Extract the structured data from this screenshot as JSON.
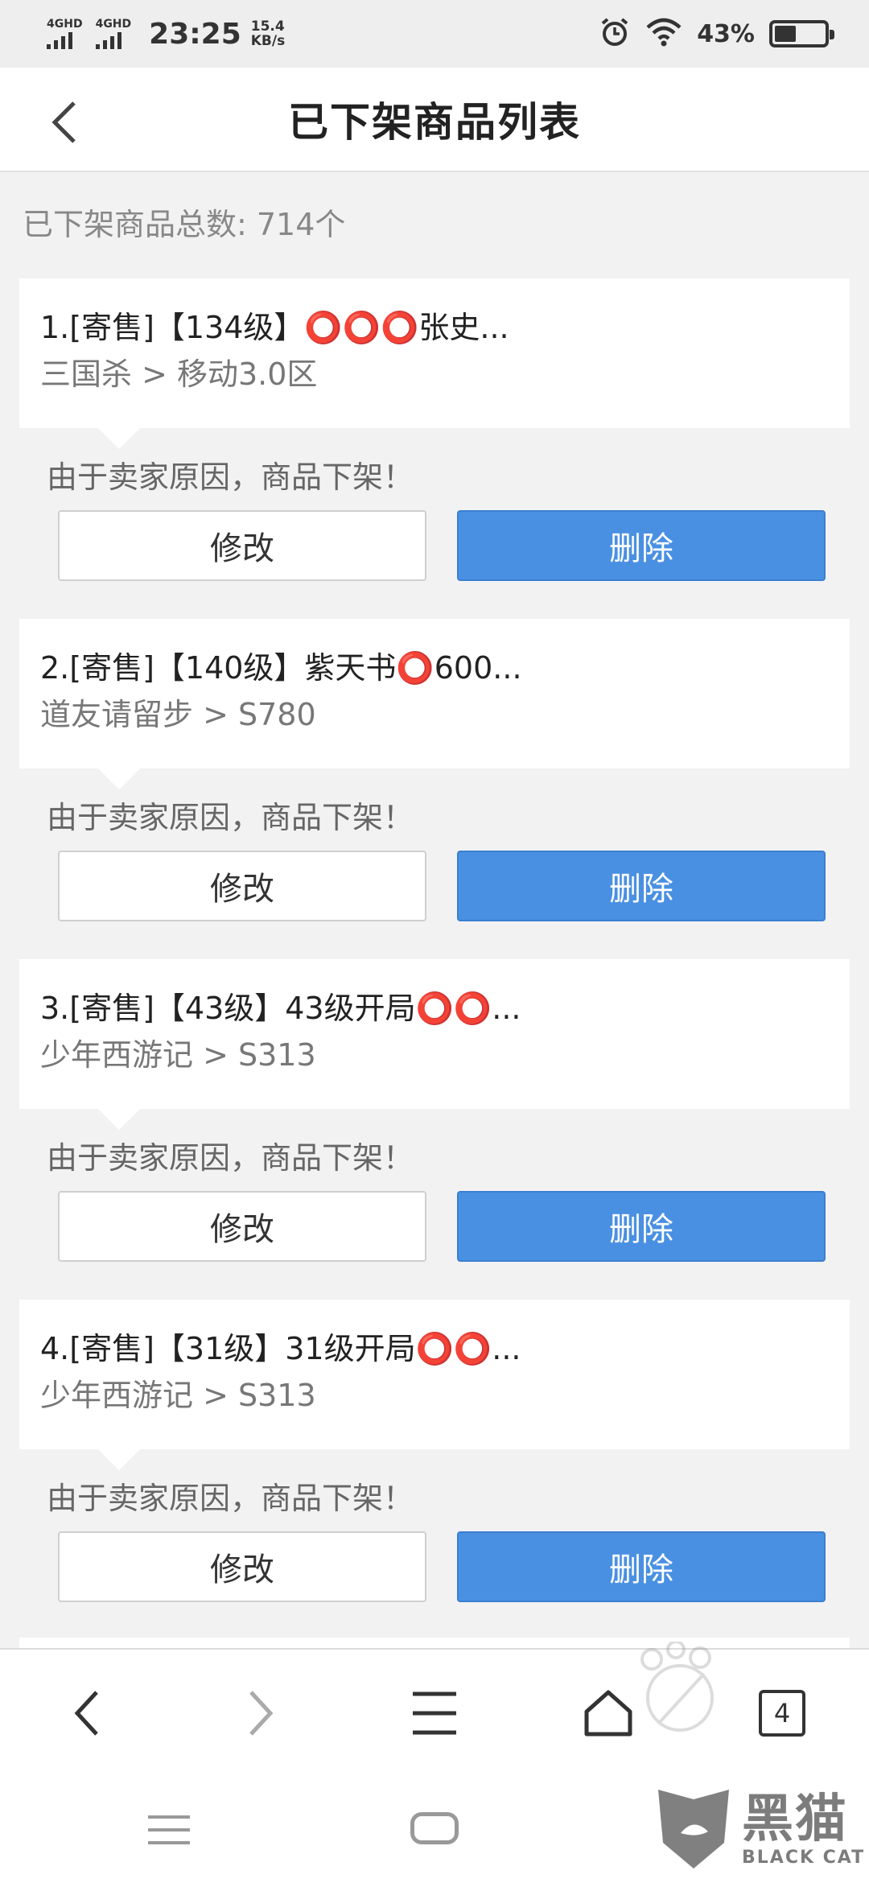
{
  "status_bar": {
    "sim1_label": "4GHD",
    "sim2_label": "4GHD",
    "time": "23:25",
    "speed_value": "15.4",
    "speed_unit": "KB/s",
    "battery_percent": "43%",
    "battery_level": 0.43
  },
  "header": {
    "title": "已下架商品列表"
  },
  "summary": {
    "text": "已下架商品总数: 714个"
  },
  "items": [
    {
      "title": "1.[寄售]【134级】⭕⭕⭕张史...",
      "subtitle": "三国杀 > 移动3.0区",
      "reason": "由于卖家原因，商品下架！",
      "edit_label": "修改",
      "delete_label": "删除"
    },
    {
      "title": "2.[寄售]【140级】紫天书⭕600...",
      "subtitle": "道友请留步 > S780",
      "reason": "由于卖家原因，商品下架！",
      "edit_label": "修改",
      "delete_label": "删除"
    },
    {
      "title": "3.[寄售]【43级】43级开局⭕⭕...",
      "subtitle": "少年西游记 > S313",
      "reason": "由于卖家原因，商品下架！",
      "edit_label": "修改",
      "delete_label": "删除"
    },
    {
      "title": "4.[寄售]【31级】31级开局⭕⭕...",
      "subtitle": "少年西游记 > S313",
      "reason": "由于卖家原因，商品下架！",
      "edit_label": "修改",
      "delete_label": "删除"
    }
  ],
  "browser_bar": {
    "tab_count": "4",
    "icons": [
      "back-arrow-icon",
      "forward-arrow-icon",
      "menu-icon",
      "home-icon",
      "tabs-icon"
    ]
  },
  "watermark": {
    "cn": "黑猫",
    "en": "BLACK CAT"
  },
  "colors": {
    "accent_blue": "#4a90e2",
    "background": "#f2f2f2"
  }
}
